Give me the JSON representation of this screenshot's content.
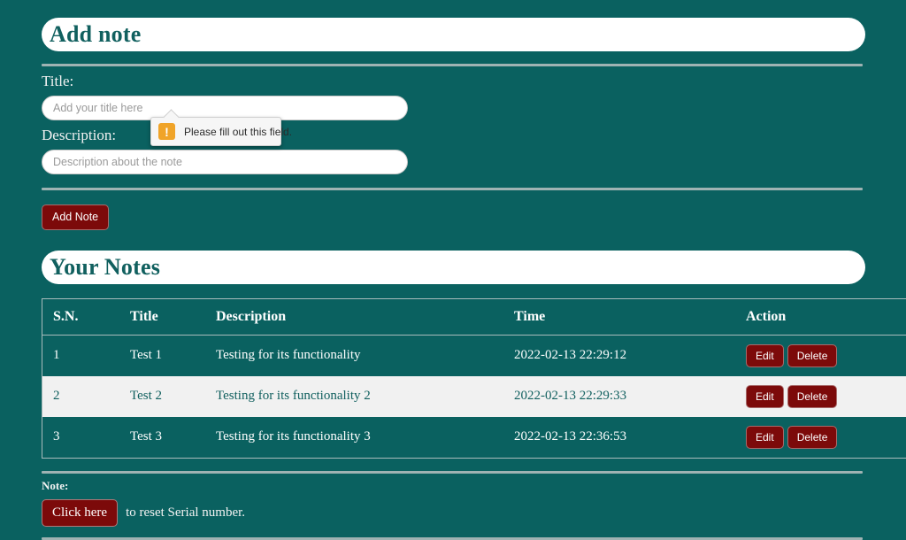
{
  "theme": {
    "background": "#0a6160",
    "accent_maroon": "#7c0a0a",
    "heading_text": "#11605f",
    "rule": "#9fb3b3",
    "stripe": "#f1f1f1",
    "warning": "#f0a429"
  },
  "add_note": {
    "heading": "Add note",
    "title_label": "Title:",
    "title_value": "",
    "title_placeholder": "Add your title here",
    "description_label": "Description:",
    "description_value": "",
    "description_placeholder": "Description about the note",
    "submit_label": "Add Note"
  },
  "validation_tooltip": {
    "icon": "warning-exclamation-icon",
    "icon_glyph": "!",
    "message": "Please fill out this field."
  },
  "your_notes": {
    "heading": "Your Notes",
    "columns": [
      "S.N.",
      "Title",
      "Description",
      "Time",
      "Action"
    ],
    "rows": [
      {
        "sn": "1",
        "title": "Test 1",
        "description": "Testing for its functionality",
        "time": "2022-02-13 22:29:12",
        "edit_label": "Edit",
        "delete_label": "Delete",
        "striped": false
      },
      {
        "sn": "2",
        "title": "Test 2",
        "description": "Testing for its functionality 2",
        "time": "2022-02-13 22:29:33",
        "edit_label": "Edit",
        "delete_label": "Delete",
        "striped": true
      },
      {
        "sn": "3",
        "title": "Test 3",
        "description": "Testing for its functionality 3",
        "time": "2022-02-13 22:36:53",
        "edit_label": "Edit",
        "delete_label": "Delete",
        "striped": false
      }
    ]
  },
  "footer_note": {
    "label": "Note:",
    "button_label": "Click here",
    "text": "to reset Serial number."
  }
}
